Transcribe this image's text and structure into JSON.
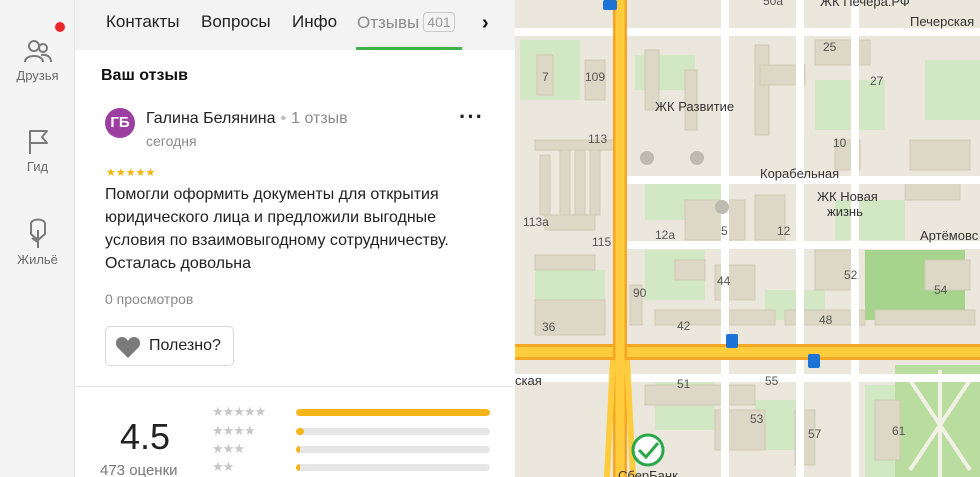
{
  "rail": {
    "items": [
      {
        "label": "Друзья",
        "icon": "friends-icon"
      },
      {
        "label": "Гид",
        "icon": "flag-icon"
      },
      {
        "label": "Жильё",
        "icon": "housing-icon"
      }
    ],
    "notification_color": "#e8262c"
  },
  "tabs": {
    "items": [
      {
        "label": "Контакты"
      },
      {
        "label": "Вопросы"
      },
      {
        "label": "Инфо"
      },
      {
        "label": "Отзывы",
        "count": "401",
        "active": true
      }
    ],
    "accent_color": "#3fb24a"
  },
  "review_section": {
    "title": "Ваш отзыв",
    "author_initials": "ГБ",
    "author_name": "Галина Белянина",
    "author_reviews": "1 отзыв",
    "date": "сегодня",
    "stars": "★★★★★",
    "rating": 5,
    "text": "Помогли оформить документы для открытия юридического лица и предложили выгодные условия по взаимовыгодному сотрудничеству. Осталась довольна",
    "views": "0 просмотров",
    "useful_label": "Полезно?"
  },
  "summary": {
    "rating": "4.5",
    "count_label": "473 оценки",
    "distribution": [
      {
        "stars": "★★★★★",
        "fraction": 1.0
      },
      {
        "stars": "★★★★",
        "fraction": 0.04
      },
      {
        "stars": "★★★",
        "fraction": 0.02
      },
      {
        "stars": "★★",
        "fraction": 0.02
      }
    ]
  },
  "map": {
    "labels": {
      "b50a": "50a",
      "zhk_pechera": "ЖК Печера.РФ",
      "pecherskaya": "Печерская",
      "b25": "25",
      "b7": "7",
      "b109": "109",
      "b27": "27",
      "zhk_razvitie": "ЖК Развитие",
      "b113": "113",
      "b10": "10",
      "korabelnaya": "Корабельная",
      "zhk_novaya": "ЖК Новая",
      "zhizn": "жизнь",
      "b113a": "113а",
      "b12a": "12а",
      "b5": "5",
      "b12": "12",
      "artemovskaya": "Артёмовс",
      "b115": "115",
      "b52": "52",
      "b90": "90",
      "b44": "44",
      "b54": "54",
      "b42": "42",
      "b48": "48",
      "b36": "36",
      "skaya": "ская",
      "b51": "51",
      "b55": "55",
      "b53": "53",
      "b57": "57",
      "b61": "61",
      "sberbank": "СберБанк"
    }
  }
}
